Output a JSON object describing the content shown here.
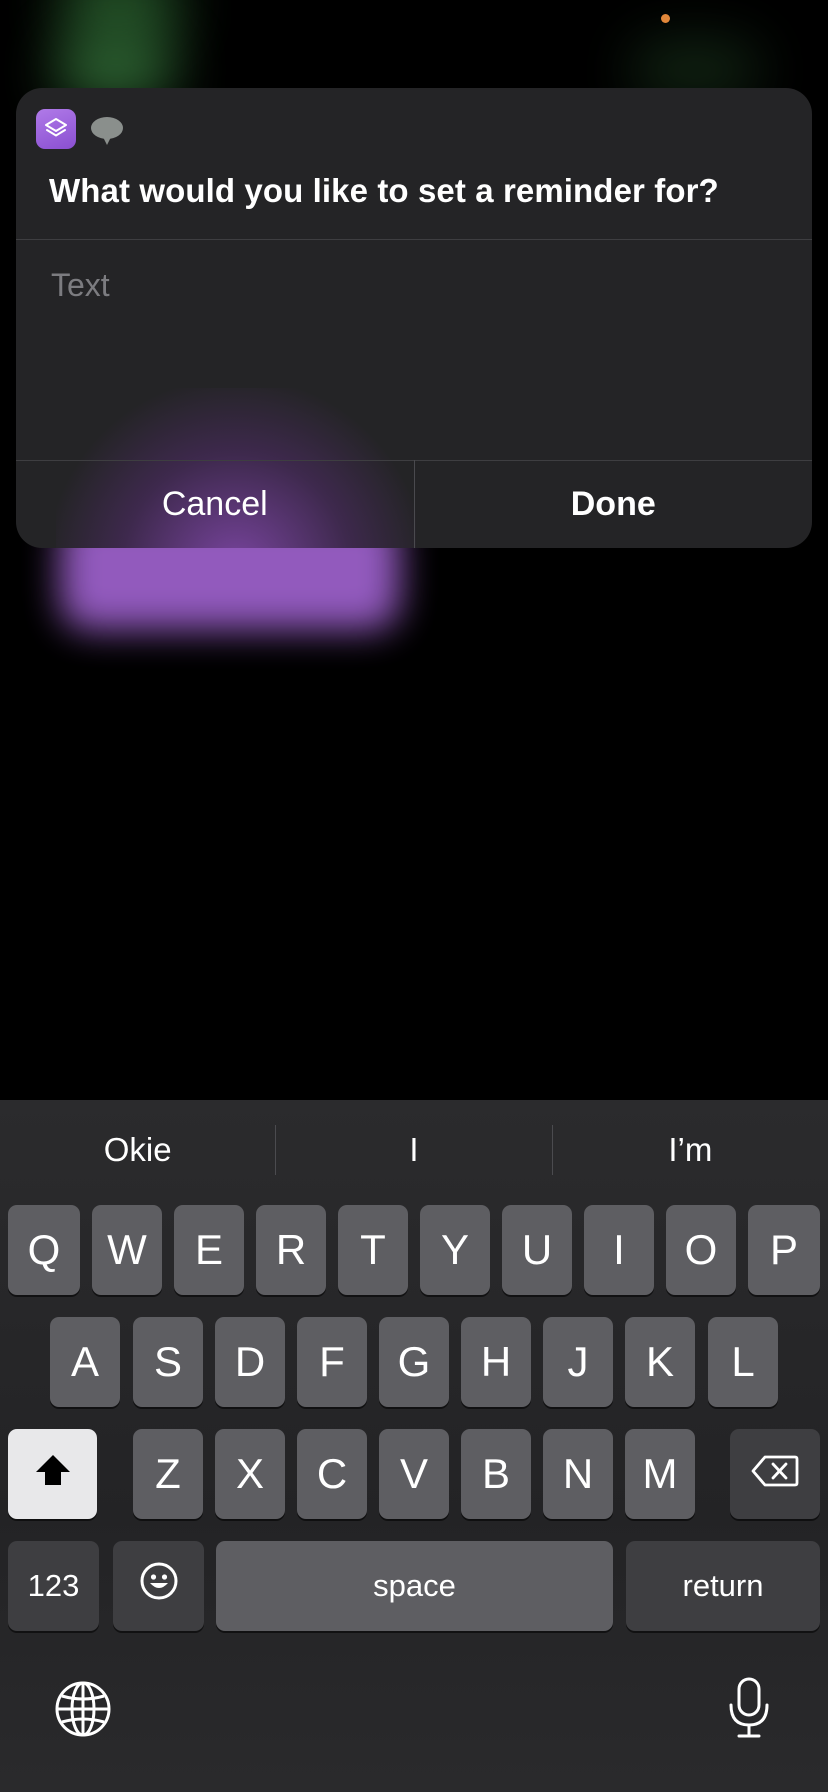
{
  "dialog": {
    "title": "What would you like to set a reminder for?",
    "input_placeholder": "Text",
    "input_value": "",
    "cancel_label": "Cancel",
    "done_label": "Done"
  },
  "keyboard": {
    "suggestions": [
      "Okie",
      "I",
      "I’m"
    ],
    "row1": [
      "Q",
      "W",
      "E",
      "R",
      "T",
      "Y",
      "U",
      "I",
      "O",
      "P"
    ],
    "row2": [
      "A",
      "S",
      "D",
      "F",
      "G",
      "H",
      "J",
      "K",
      "L"
    ],
    "row3": [
      "Z",
      "X",
      "C",
      "V",
      "B",
      "N",
      "M"
    ],
    "numbers_label": "123",
    "space_label": "space",
    "return_label": "return"
  },
  "icons": {
    "app": "shortcuts-icon",
    "siri": "speech-bubble-icon",
    "shift": "shift-icon",
    "delete": "delete-icon",
    "emoji": "emoji-icon",
    "globe": "globe-icon",
    "mic": "microphone-icon"
  },
  "colors": {
    "dialog_bg": "#242426",
    "accent_purple": "#9a5fc8",
    "key_bg": "#5e5e62",
    "key_dark_bg": "#3e3e41",
    "shift_bg": "#e8e8ea"
  }
}
